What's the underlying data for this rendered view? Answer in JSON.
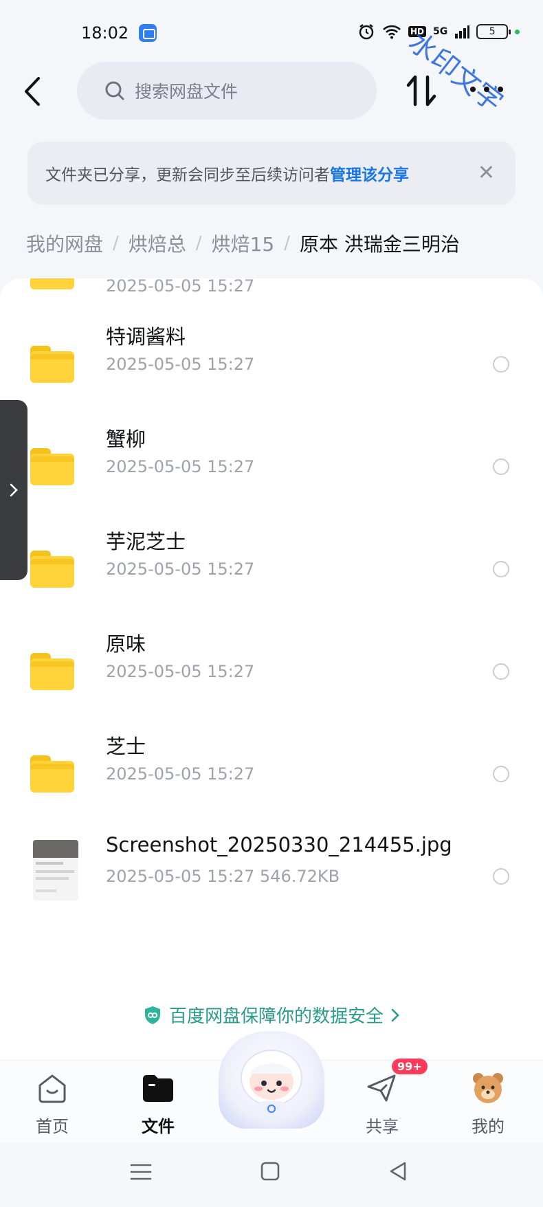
{
  "status_bar": {
    "time": "18:02",
    "hd_label": "HD",
    "network_label": "5G",
    "battery_level": "5",
    "watermark": "水印文字"
  },
  "top_bar": {
    "search_placeholder": "搜索网盘文件"
  },
  "notice": {
    "text": "文件夹已分享，更新会同步至后续访问者",
    "link": "管理该分享",
    "close": "✕"
  },
  "breadcrumb": {
    "items": [
      "我的网盘",
      "烘焙总",
      "烘焙15"
    ],
    "separator": "/",
    "current": "原本 洪瑞金三明治"
  },
  "files": [
    {
      "name": "",
      "meta": "2025-05-05  15:27"
    },
    {
      "name": "特调酱料",
      "meta": "2025-05-05  15:27"
    },
    {
      "name": "蟹柳",
      "meta": "2025-05-05  15:27"
    },
    {
      "name": "芋泥芝士",
      "meta": "2025-05-05  15:27"
    },
    {
      "name": "原味",
      "meta": "2025-05-05  15:27"
    },
    {
      "name": "芝士",
      "meta": "2025-05-05  15:27"
    },
    {
      "name": "Screenshot_20250330_214455.jpg",
      "meta": "2025-05-05  15:27   546.72KB"
    }
  ],
  "security_banner": "百度网盘保障你的数据安全",
  "bottom_nav": {
    "home": "首页",
    "files": "文件",
    "share": "共享",
    "share_badge": "99+",
    "me": "我的"
  },
  "colors": {
    "accent": "#1876e6",
    "folder": "#ffd43a",
    "security": "#2a9a8a",
    "badge": "#ff3b5b"
  }
}
